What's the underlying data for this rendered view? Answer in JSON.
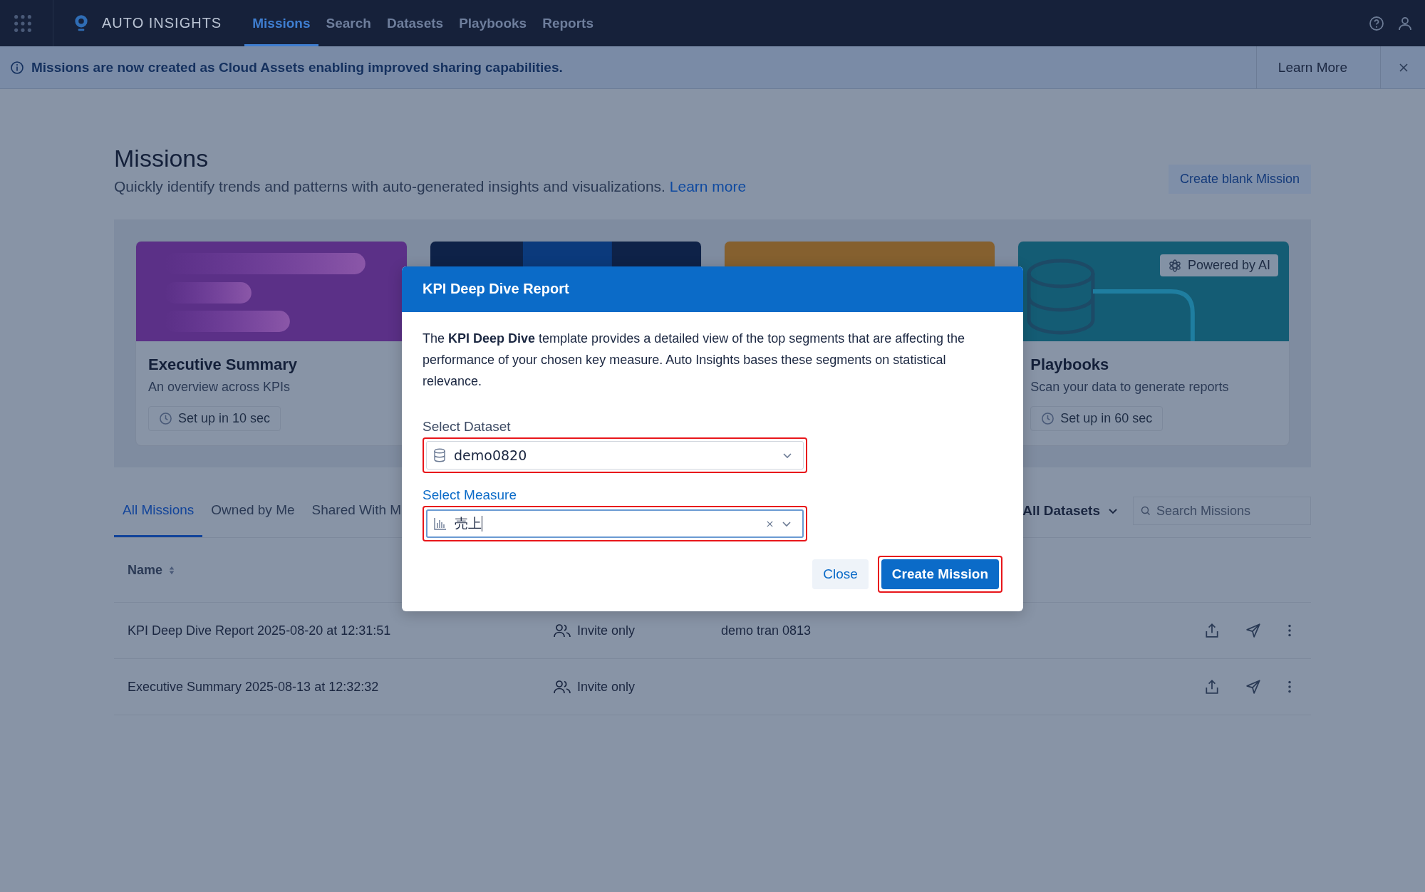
{
  "nav": {
    "app_title": "AUTO INSIGHTS",
    "items": [
      {
        "label": "Missions",
        "selected": true
      },
      {
        "label": "Search",
        "selected": false
      },
      {
        "label": "Datasets",
        "selected": false
      },
      {
        "label": "Playbooks",
        "selected": false
      },
      {
        "label": "Reports",
        "selected": false
      }
    ]
  },
  "banner": {
    "message": "Missions are now created as Cloud Assets enabling improved sharing capabilities.",
    "action": "Learn More"
  },
  "header": {
    "title": "Missions",
    "subtitle": "Quickly identify trends and patterns with auto-generated insights and visualizations.",
    "link": "Learn more",
    "button": "Create blank Mission"
  },
  "templates": [
    {
      "kind": "bars",
      "color": "#5b3087",
      "title": "Executive Summary",
      "description": "An overview across KPIs",
      "setup": "Set up in 10 sec"
    },
    {
      "kind": "blocks",
      "color": "#0e2248"
    },
    {
      "kind": "plain",
      "color": "#85602f"
    },
    {
      "kind": "database",
      "color": "#145c74",
      "badge": "Powered by AI",
      "title": "Playbooks",
      "description": "Scan your data to generate reports",
      "setup": "Set up in 60 sec"
    }
  ],
  "tabs": [
    {
      "label": "All Missions",
      "selected": true
    },
    {
      "label": "Owned by Me",
      "selected": false
    },
    {
      "label": "Shared With M",
      "selected": false
    }
  ],
  "filter": "All Datasets",
  "search": {
    "placeholder": "Search Missions"
  },
  "table": {
    "columns": [
      "Name"
    ],
    "rows": [
      {
        "name": "KPI Deep Dive Report 2025-08-20 at 12:31:51",
        "sharing": "Invite only",
        "dataset": "demo tran 0813"
      },
      {
        "name": "Executive Summary 2025-08-13 at 12:32:32",
        "sharing": "Invite only"
      }
    ]
  },
  "dialog": {
    "title": "KPI Deep Dive Report",
    "description": "The **KPI Deep Dive** template provides a detailed view of the top segments that are affecting the performance of your chosen key measure. Auto Insights bases these segments on statistical relevance.",
    "fields": [
      {
        "kind": "dataset",
        "label": "Select Dataset",
        "value": "demo0820",
        "focused": false,
        "highlighted": true
      },
      {
        "kind": "measure",
        "label": "Select Measure",
        "value": "売上",
        "focused": true,
        "highlighted": true
      }
    ],
    "buttons": [
      {
        "label": "Close",
        "kind": "secondary",
        "highlighted": false
      },
      {
        "label": "Create Mission",
        "kind": "primary",
        "highlighted": true
      }
    ]
  }
}
